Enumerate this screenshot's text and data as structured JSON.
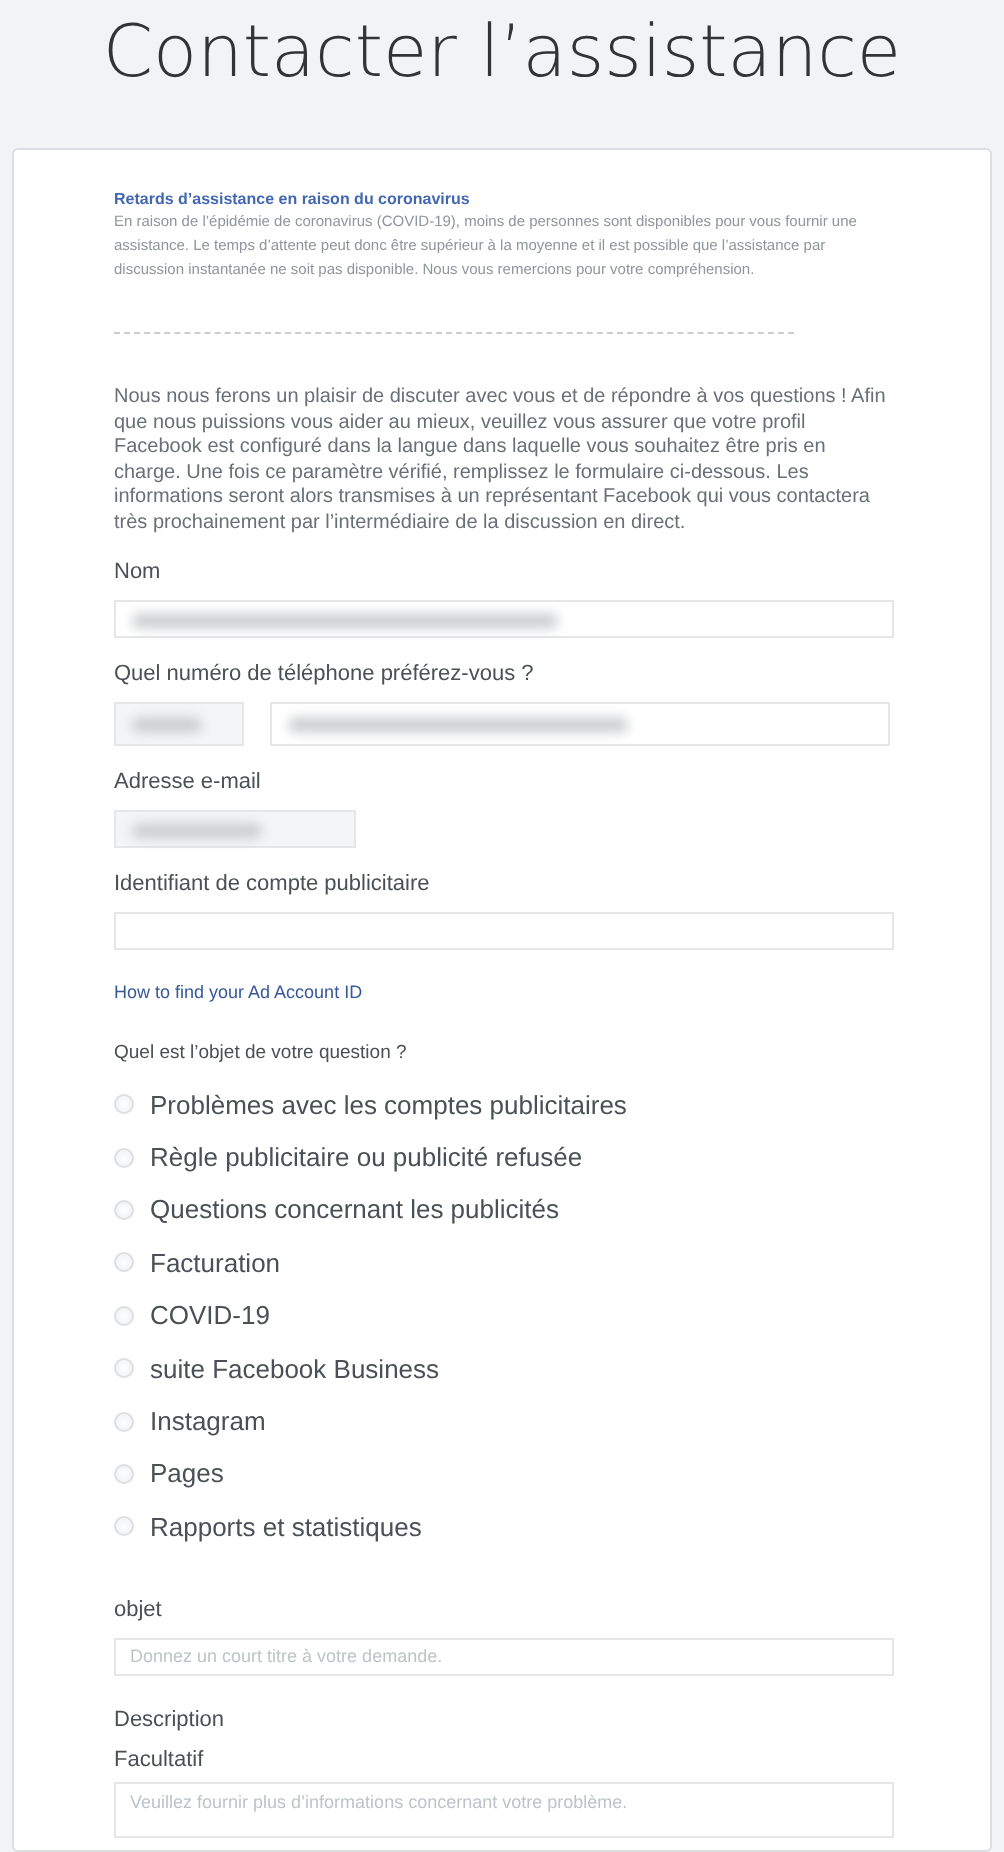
{
  "page_title": "Contacter l’assistance",
  "notice": {
    "title": "Retards d’assistance en raison du coronavirus",
    "text": "En raison de l’épidémie de coronavirus (COVID-19), moins de personnes sont disponibles pour vous fournir une assistance. Le temps d’attente peut donc être supérieur à la moyenne et il est possible que l’assistance par discussion instantanée ne soit pas disponible. Nous vous remercions pour votre compréhension."
  },
  "intro": "Nous nous ferons un plaisir de discuter avec vous et de répondre à vos questions ! Afin que nous puissions vous aider au mieux, veuillez vous assurer que votre profil Facebook est configuré dans la langue dans laquelle vous souhaitez être pris en charge. Une fois ce paramètre vérifié, remplissez le formulaire ci-dessous. Les informations seront alors transmises à un représentant Facebook qui vous contactera très prochainement par l’intermédiaire de la discussion en direct.",
  "name_field": {
    "label": "Nom",
    "redacted": true
  },
  "phone_field": {
    "label": "Quel numéro de téléphone préférez-vous ?",
    "country_redacted": true,
    "number_redacted": true
  },
  "email_field": {
    "label": "Adresse e-mail",
    "redacted": true
  },
  "ad_account_field": {
    "label": "Identifiant de compte publicitaire",
    "redacted": false
  },
  "help_link": "How to find your Ad Account ID",
  "question": {
    "label": "Quel est l’objet de votre question ?",
    "options": [
      {
        "label": "Problèmes avec les comptes publicitaires",
        "selected": false
      },
      {
        "label": "Règle publicitaire ou publicité refusée",
        "selected": false
      },
      {
        "label": "Questions concernant les publicités",
        "selected": false
      },
      {
        "label": "Facturation",
        "selected": false
      },
      {
        "label": "COVID-19",
        "selected": false
      },
      {
        "label": "suite Facebook Business",
        "selected": false
      },
      {
        "label": "Instagram",
        "selected": false
      },
      {
        "label": "Pages",
        "selected": false
      },
      {
        "label": "Rapports et statistiques",
        "selected": false
      }
    ]
  },
  "subject_field": {
    "label": "objet",
    "placeholder": "Donnez un court titre à votre demande."
  },
  "description_field": {
    "label": "Description",
    "sublabel": "Facultatif",
    "placeholder": "Veuillez fournir plus d’informations concernant votre problème."
  }
}
